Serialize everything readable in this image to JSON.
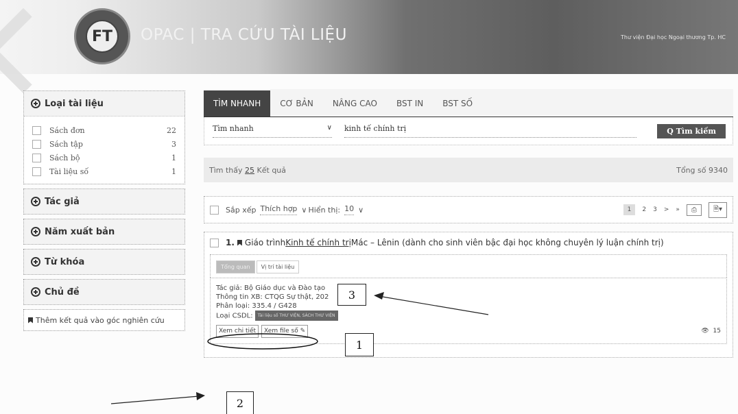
{
  "header": {
    "title": "OPAC | TRA CỨU TÀI LIỆU",
    "library": "Thư viện Đại học Ngoại thương Tp. HC",
    "logo_text": "FT"
  },
  "sidebar": {
    "doc_type": {
      "title": "Loại tài liệu",
      "items": [
        {
          "label": "Sách đơn",
          "count": "22"
        },
        {
          "label": "Sách tập",
          "count": "3"
        },
        {
          "label": "Sách bộ",
          "count": "1"
        },
        {
          "label": "Tài liệu số",
          "count": "1"
        }
      ]
    },
    "author": "Tác giả",
    "year": "Năm xuất bản",
    "keyword": "Từ khóa",
    "subject": "Chủ đề",
    "add_research": "Thêm kết quả vào góc nghiên cứu"
  },
  "tabs": [
    "TÌM NHANH",
    "CƠ BẢN",
    "NÂNG CAO",
    "BST IN",
    "BST SỐ"
  ],
  "search": {
    "mode": "Tìm nhanh",
    "query": "kinh tế chính trị",
    "button": "Tìm kiếm"
  },
  "results": {
    "found_prefix": "Tìm thấy",
    "found_count": "25",
    "found_suffix": "Kết quả",
    "total": "Tổng số 9340"
  },
  "sort": {
    "label": "Sắp xếp",
    "value": "Thích hợp",
    "show_label": "Hiển thị:",
    "show_value": "10",
    "pages": [
      "1",
      "2",
      "3",
      ">",
      "»"
    ]
  },
  "result1": {
    "number": "1.",
    "title_pre": "Giáo trình ",
    "title_hl": "Kinh tế chính trị",
    "title_post": " Mác – Lênin (dành cho sinh viên bậc đại học không chuyên lý luận chính trị)",
    "tab_overview": "Tổng quan",
    "tab_location": "Vị trí tài liệu",
    "author": "Tác giả: Bộ Giáo dục và Đào tạo",
    "publish": "Thông tin XB: CTQG Sự thật, 202",
    "classification": "Phân loại: 335.4 / G428",
    "csdl_label": "Loại CSDL:",
    "csdl_badge": "Tài liệu số THƯ VIỆN, SÁCH THƯ VIỆN",
    "btn_detail": "Xem chi tiết",
    "btn_file": "Xem file số",
    "views": "15"
  },
  "annotations": {
    "one": "1",
    "two": "2",
    "three": "3"
  }
}
